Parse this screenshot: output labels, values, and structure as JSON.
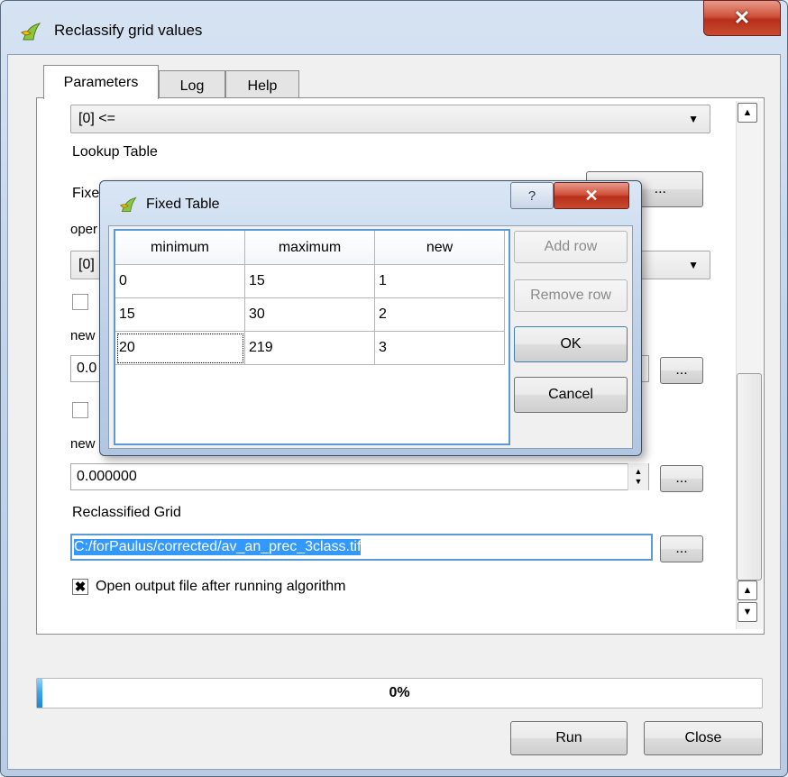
{
  "window": {
    "title": "Reclassify grid values",
    "close_glyph": "✕"
  },
  "tabs": [
    {
      "label": "Parameters"
    },
    {
      "label": "Log"
    },
    {
      "label": "Help"
    }
  ],
  "params": {
    "method_combo": "[0] <=",
    "lookup_table_label": "Lookup Table",
    "fixed_label_partial": "Fixe",
    "fixed_button_partial": "...",
    "operator_label_partial": "oper",
    "operator_combo_partial": "[0]",
    "new_label_partial_1": "new",
    "new_value_partial_1": "0.0",
    "browse_label": "...",
    "new_label_partial_2": "new",
    "new_value_2": "0.000000",
    "reclassified_grid_label": "Reclassified Grid",
    "reclassified_grid_value": "C:/forPaulus/corrected/av_an_prec_3class.tif",
    "open_output_label": "Open output file after running algorithm",
    "open_output_checked": true
  },
  "progress": {
    "text": "0%",
    "value": 0.005
  },
  "buttons": {
    "run": "Run",
    "close": "Close"
  },
  "modal": {
    "title": "Fixed Table",
    "help_glyph": "?",
    "close_glyph": "✕",
    "columns": [
      "minimum",
      "maximum",
      "new"
    ],
    "rows": [
      [
        "0",
        "15",
        "1"
      ],
      [
        "15",
        "30",
        "2"
      ],
      [
        "20",
        "219",
        "3"
      ]
    ],
    "buttons": {
      "add_row": "Add row",
      "remove_row": "Remove row",
      "ok": "OK",
      "cancel": "Cancel"
    }
  },
  "colors": {
    "accent": "#5b9bd5",
    "close_red": "#c84a2e",
    "selection": "#3399ff"
  }
}
